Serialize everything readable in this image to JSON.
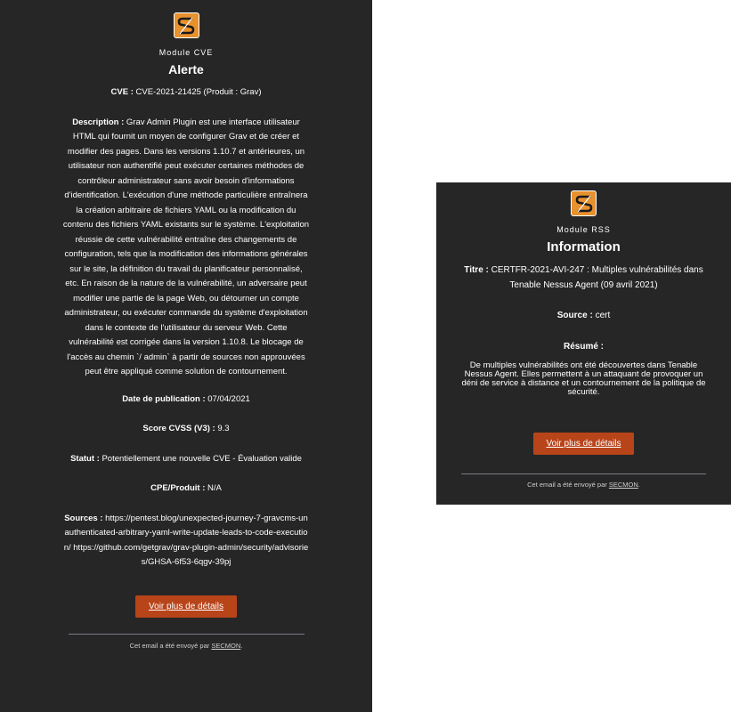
{
  "cve_email": {
    "module": "Module CVE",
    "title": "Alerte",
    "cve_label": "CVE :",
    "cve_value": "CVE-2021-21425 (Produit : Grav)",
    "description_label": "Description :",
    "description_value": "Grav Admin Plugin est une interface utilisateur HTML qui fournit un moyen de configurer Grav et de créer et modifier des pages. Dans les versions 1.10.7 et antérieures, un utilisateur non authentifié peut exécuter certaines méthodes de contrôleur administrateur sans avoir besoin d'informations d'identification. L'exécution d'une méthode particulière entraînera la création arbitraire de fichiers YAML ou la modification du contenu des fichiers YAML existants sur le système. L'exploitation réussie de cette vulnérabilité entraîne des changements de configuration, tels que la modification des informations générales sur le site, la définition du travail du planificateur personnalisé, etc. En raison de la nature de la vulnérabilité, un adversaire peut modifier une partie de la page Web, ou détourner un compte administrateur, ou exécuter commande du système d'exploitation dans le contexte de l'utilisateur du serveur Web. Cette vulnérabilité est corrigée dans la version 1.10.8. Le blocage de l'accès au chemin `/ admin` à partir de sources non approuvées peut être appliqué comme solution de contournement.",
    "date_label": "Date de publication :",
    "date_value": "07/04/2021",
    "score_label": "Score CVSS (V3) :",
    "score_value": "9.3",
    "status_label": "Statut :",
    "status_value": "Potentiellement une nouvelle CVE - Évaluation valide",
    "cpe_label": "CPE/Produit :",
    "cpe_value": "N/A",
    "sources_label": "Sources :",
    "sources_value": "https://pentest.blog/unexpected-journey-7-gravcms-unauthenticated-arbitrary-yaml-write-update-leads-to-code-execution/ https://github.com/getgrav/grav-plugin-admin/security/advisories/GHSA-6f53-6qgv-39pj",
    "button": "Voir plus de détails",
    "footer_prefix": "Cet email a été envoyé par",
    "footer_link": "SECMON",
    "footer_suffix": "."
  },
  "rss_email": {
    "module": "Module RSS",
    "title": "Information",
    "titre_label": "Titre :",
    "titre_value": "CERTFR-2021-AVI-247 : Multiples vulnérabilités dans Tenable Nessus Agent (09 avril 2021)",
    "source_label": "Source :",
    "source_value": "cert",
    "resume_label": "Résumé :",
    "resume_value": "De multiples vulnérabilités ont été découvertes dans Tenable Nessus Agent. Elles permettent à un attaquant de provoquer un déni de service à distance et un contournement de la politique de sécurité.",
    "button": "Voir plus de détails",
    "footer_prefix": "Cet email a été envoyé par",
    "footer_link": "SECMON",
    "footer_suffix": "."
  },
  "colors": {
    "card_bg": "#262626",
    "logo_orange": "#e8912f",
    "button_bg": "#b8441a",
    "divider": "#7a7a86"
  },
  "icons": {
    "logo": "secmon-logo-icon"
  }
}
